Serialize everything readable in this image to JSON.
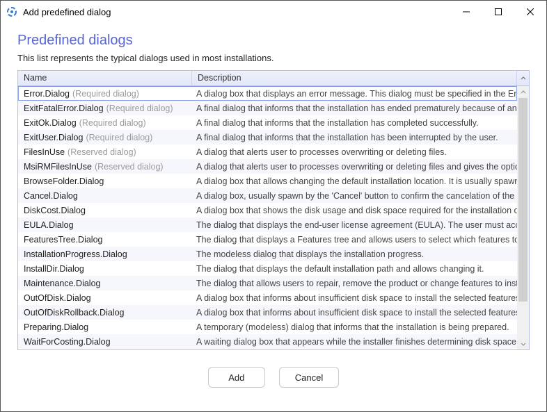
{
  "window": {
    "title": "Add predefined dialog"
  },
  "page": {
    "heading": "Predefined dialogs",
    "subtitle": "This list represents the typical dialogs used in most installations."
  },
  "table": {
    "columns": {
      "name": "Name",
      "description": "Description"
    },
    "rows": [
      {
        "name": "Error.Dialog",
        "tag": "(Required dialog)",
        "desc": "A dialog box that displays an error message. This dialog must be specified in the ErrorDialog",
        "selected": true
      },
      {
        "name": "ExitFatalError.Dialog",
        "tag": "(Required dialog)",
        "desc": "A final dialog that informs that the installation has ended prematurely because of an error."
      },
      {
        "name": "ExitOk.Dialog",
        "tag": "(Required dialog)",
        "desc": "A final dialog that informs that the installation has completed successfully."
      },
      {
        "name": "ExitUser.Dialog",
        "tag": "(Required dialog)",
        "desc": "A final dialog that informs that the installation has been interrupted by the user."
      },
      {
        "name": "FilesInUse",
        "tag": "(Reserved dialog)",
        "desc": "A dialog that alerts user to processes overwriting or deleting files."
      },
      {
        "name": "MsiRMFilesInUse",
        "tag": "(Reserved dialog)",
        "desc": "A dialog that alerts user to processes overwriting or deleting files and gives the option to use"
      },
      {
        "name": "BrowseFolder.Dialog",
        "tag": "",
        "desc": "A dialog box that allows changing the default installation location. It is usually spawn by the '"
      },
      {
        "name": "Cancel.Dialog",
        "tag": "",
        "desc": "A dialog box, usually spawn by the 'Cancel' button to confirm the cancelation of the installati"
      },
      {
        "name": "DiskCost.Dialog",
        "tag": "",
        "desc": "A dialog box that shows the disk usage and disk space required for the installation of the sele"
      },
      {
        "name": "EULA.Dialog",
        "tag": "",
        "desc": "The dialog that displays the end-user license agreement (EULA). The user must accept the lic"
      },
      {
        "name": "FeaturesTree.Dialog",
        "tag": "",
        "desc": "The dialog that displays a Features tree and allows users to select which features to install."
      },
      {
        "name": "InstallationProgress.Dialog",
        "tag": "",
        "desc": "The modeless dialog that displays the installation progress."
      },
      {
        "name": "InstallDir.Dialog",
        "tag": "",
        "desc": "The dialog that displays the default installation path and allows changing it."
      },
      {
        "name": "Maintenance.Dialog",
        "tag": "",
        "desc": "The dialog that allows users to repair, remove the product or change features to install."
      },
      {
        "name": "OutOfDisk.Dialog",
        "tag": "",
        "desc": "A dialog box that informs about insufficient disk space to install the selected features. It is us"
      },
      {
        "name": "OutOfDiskRollback.Dialog",
        "tag": "",
        "desc": "A dialog box that informs about insufficient disk space to install the selected features and sug"
      },
      {
        "name": "Preparing.Dialog",
        "tag": "",
        "desc": "A temporary (modeless) dialog that informs that the installation is being prepared."
      },
      {
        "name": "WaitForCosting.Dialog",
        "tag": "",
        "desc": "A waiting dialog box that appears while the installer finishes determining disk space requirem"
      }
    ]
  },
  "footer": {
    "add": "Add",
    "cancel": "Cancel"
  }
}
